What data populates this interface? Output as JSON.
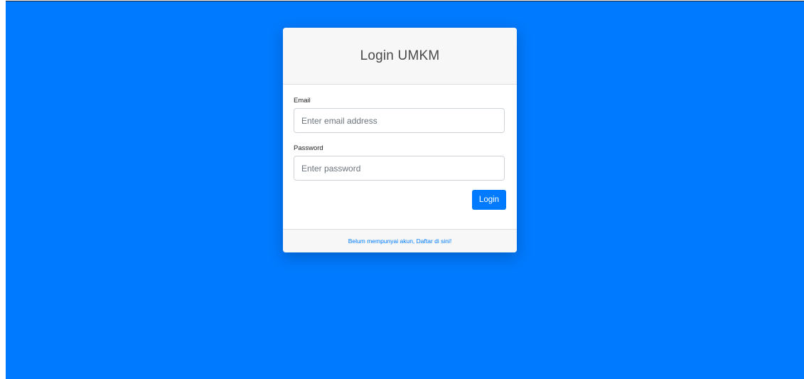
{
  "login_card": {
    "title": "Login UMKM",
    "email": {
      "label": "Email",
      "placeholder": "Enter email address",
      "value": ""
    },
    "password": {
      "label": "Password",
      "placeholder": "Enter password",
      "value": ""
    },
    "submit_label": "Login",
    "register_link": "Belum mempunyai akun, Daftar di sini!"
  },
  "colors": {
    "background": "#007bff",
    "accent": "#007bff",
    "card_header": "#f7f7f7"
  }
}
